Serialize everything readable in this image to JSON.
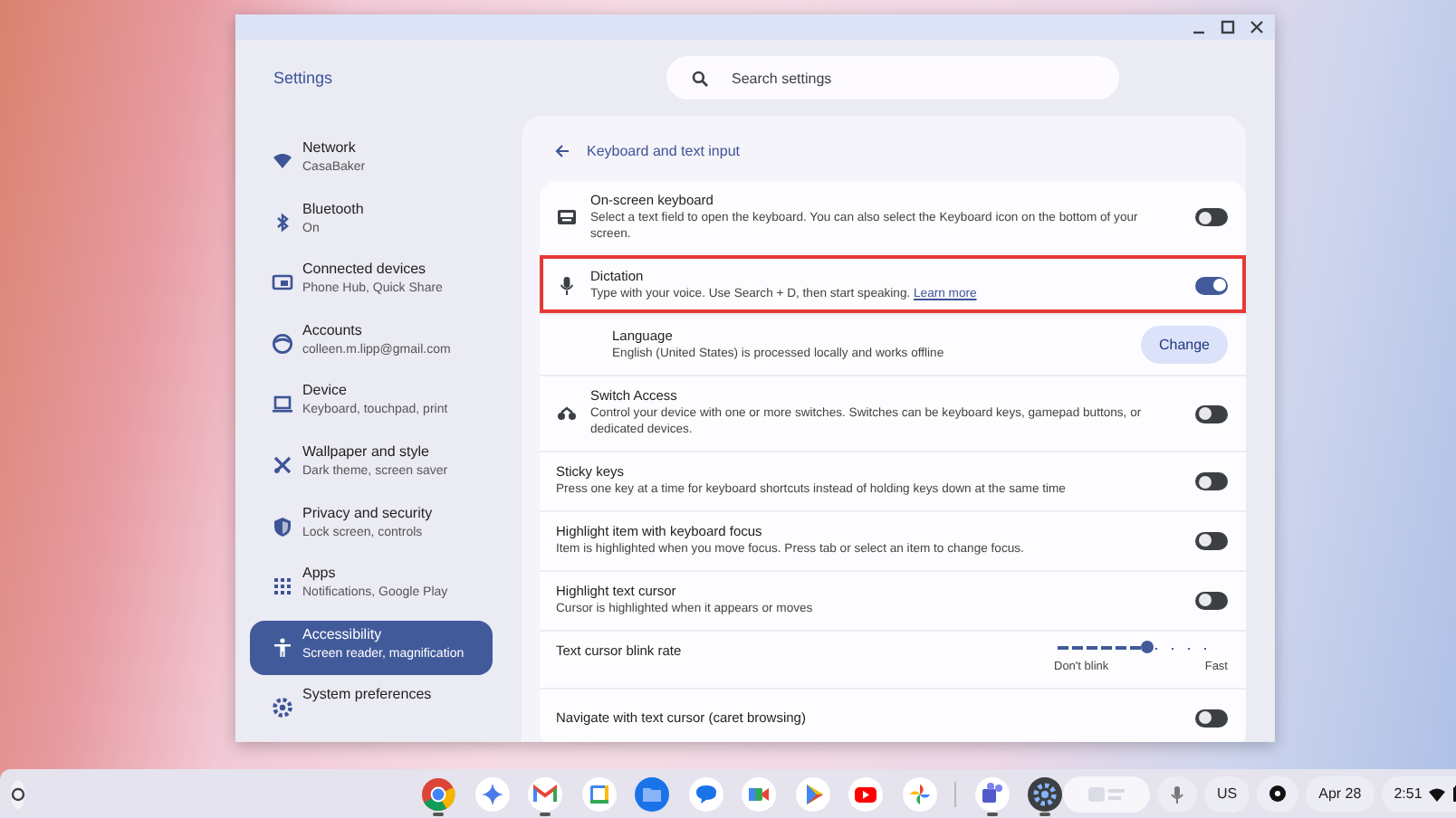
{
  "window": {
    "title": "Settings",
    "search": {
      "placeholder": "Search settings"
    }
  },
  "sidebar": {
    "items": [
      {
        "title": "Network",
        "subtitle": "CasaBaker",
        "selected": false
      },
      {
        "title": "Bluetooth",
        "subtitle": "On",
        "selected": false
      },
      {
        "title": "Connected devices",
        "subtitle": "Phone Hub, Quick Share",
        "selected": false
      },
      {
        "title": "Accounts",
        "subtitle": "colleen.m.lipp@gmail.com",
        "selected": false
      },
      {
        "title": "Device",
        "subtitle": "Keyboard, touchpad, print",
        "selected": false
      },
      {
        "title": "Wallpaper and style",
        "subtitle": "Dark theme, screen saver",
        "selected": false
      },
      {
        "title": "Privacy and security",
        "subtitle": "Lock screen, controls",
        "selected": false
      },
      {
        "title": "Apps",
        "subtitle": "Notifications, Google Play",
        "selected": false
      },
      {
        "title": "Accessibility",
        "subtitle": "Screen reader, magnification",
        "selected": true
      },
      {
        "title": "System preferences",
        "selected": false
      }
    ]
  },
  "page": {
    "title": "Keyboard and text input",
    "rows": [
      {
        "kind": "toggle",
        "title": "On-screen keyboard",
        "description": "Select a text field to open the keyboard. You can also select the Keyboard icon on the bottom of your screen.",
        "on": false,
        "highlighted": false
      },
      {
        "kind": "toggle",
        "title": "Dictation",
        "description": "Type with your voice. Use Search + D, then start speaking.",
        "link": "Learn more",
        "on": true,
        "highlighted": true,
        "children": [
          {
            "kind": "button",
            "title": "Language",
            "description": "English (United States) is processed locally and works offline",
            "button": "Change"
          }
        ]
      },
      {
        "kind": "toggle",
        "title": "Switch Access",
        "description": "Control your device with one or more switches. Switches can be keyboard keys, gamepad buttons, or dedicated devices.",
        "on": false,
        "highlighted": false
      },
      {
        "kind": "toggle",
        "title": "Sticky keys",
        "description": "Press one key at a time for keyboard shortcuts instead of holding keys down at the same time",
        "on": false,
        "highlighted": false
      },
      {
        "kind": "toggle",
        "title": "Highlight item with keyboard focus",
        "description": "Item is highlighted when you move focus. Press tab or select an item to change focus.",
        "on": false,
        "highlighted": false
      },
      {
        "kind": "toggle",
        "title": "Highlight text cursor",
        "description": "Cursor is highlighted when it appears or moves",
        "on": false,
        "highlighted": false
      },
      {
        "kind": "slider",
        "title": "Text cursor blink rate",
        "level": 0.55,
        "min_label": "Don't blink",
        "max_label": "Fast"
      },
      {
        "kind": "toggle",
        "title": "Navigate with text cursor (caret browsing)",
        "on": false,
        "highlighted": false
      }
    ]
  },
  "shelf": {
    "apps": [
      {
        "running": true
      },
      {
        "running": false
      },
      {
        "running": true
      },
      {
        "running": false
      },
      {
        "running": false
      },
      {
        "running": false
      },
      {
        "running": false
      },
      {
        "running": false
      },
      {
        "running": false
      },
      {
        "running": false
      },
      {
        "running": true
      },
      {
        "running": true
      }
    ],
    "keyboard_layout": "US",
    "date": "Apr 28",
    "time": "2:51"
  }
}
